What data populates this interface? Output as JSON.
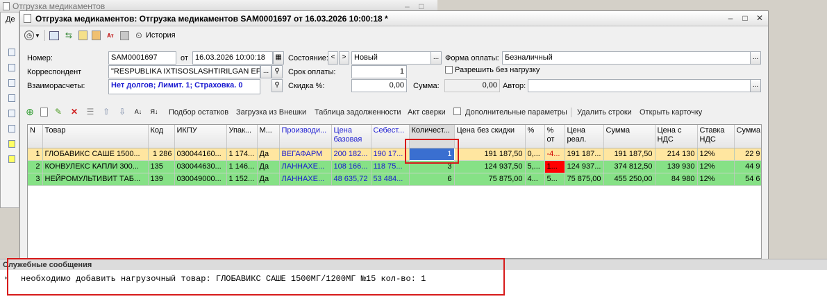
{
  "bg_window": {
    "title": "Отгрузка медикаментов",
    "side_text": "Дe"
  },
  "window": {
    "title": "Отгрузка медикаментов: Отгрузка медикаментов SAM0001697 от 16.03.2026 10:00:18 *",
    "min": "–",
    "max": "□",
    "close": "✕"
  },
  "toolbar": {
    "history": "История"
  },
  "form": {
    "number_label": "Номер:",
    "number": "SAM0001697",
    "from_label": "от",
    "date": "16.03.2026 10:00:18",
    "state_label": "Состояние:",
    "state": "Новый",
    "payment_form_label": "Форма оплаты:",
    "payment_form": "Безналичный",
    "correspondent_label": "Корреспондент",
    "correspondent": "\"RESPUBLIKA IXTISOSLASHTIRILGAN EP",
    "term_label": "Срок оплаты:",
    "term": "1",
    "allow_label": "Разрешить без нагрузку",
    "settlements_label": "Взаиморасчеты:",
    "settlements": "Нет долгов; Лимит. 1; Страховка. 0",
    "discount_label": "Скидка %:",
    "discount": "0,00",
    "sum_label": "Сумма:",
    "sum": "0,00",
    "author_label": "Автор:",
    "author": ""
  },
  "actions": [
    "Подбор остатков",
    "Загрузка из Внешки",
    "Таблица задолженности",
    "Акт сверки",
    "Дополнительные параметры",
    "Удалить строки",
    "Открыть карточку"
  ],
  "table": {
    "headers": [
      "N",
      "Товар",
      "Код",
      "ИКПУ",
      "Упак...",
      "М...",
      "Производи...",
      "Цена базовая",
      "Себест...",
      "Количест...",
      "Цена без скидки",
      "%",
      "% от",
      "Цена реал.",
      "Сумма",
      "Цена с НДС",
      "Ставка НДС",
      "Сумма"
    ],
    "rows": [
      [
        "1",
        "ГЛОБАВИКС САШЕ 1500...",
        "1 286",
        "030044160...",
        "1 174...",
        "Да",
        "ВЕГАФАРМ",
        "200 182...",
        "190 17...",
        "1",
        "191 187,50",
        "0,...",
        "-4...",
        "191 187...",
        "191 187,50",
        "214 130",
        "12%",
        "22 9"
      ],
      [
        "2",
        "КОНВУЛЕКС КАПЛИ 300...",
        "135",
        "030044630...",
        "1 146...",
        "Да",
        "ЛАННАХЕ...",
        "108 166...",
        "118 75...",
        "3",
        "124 937,50",
        "5,...",
        "1...",
        "124 937...",
        "374 812,50",
        "139 930",
        "12%",
        "44 9"
      ],
      [
        "3",
        "НЕЙРОМУЛЬТИВИТ ТАБ...",
        "139",
        "030049000...",
        "1 152...",
        "Да",
        "ЛАННАХЕ...",
        "48 635,72",
        "53 484...",
        "6",
        "75 875,00",
        "4...",
        "5...",
        "75 875,00",
        "455 250,00",
        "84 980",
        "12%",
        "54 6"
      ]
    ]
  },
  "messages": {
    "header": "Служебные сообщения",
    "text": "необходимо добавить нагрузочный товар: ГЛОБАВИКС САШЕ 1500МГ/1200МГ №15 кол-во: 1"
  },
  "colors": {
    "row_yellow": "#ffe6a0",
    "row_green": "#86e186",
    "selection": "#3a6fd0",
    "highlight": "#d71a1a"
  }
}
